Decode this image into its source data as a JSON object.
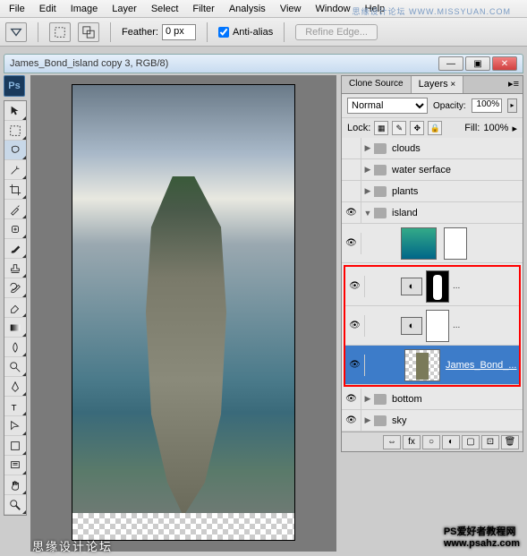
{
  "menu": {
    "items": [
      "File",
      "Edit",
      "Image",
      "Layer",
      "Select",
      "Filter",
      "Analysis",
      "View",
      "Window",
      "Help"
    ],
    "watermark": "思缘设计论坛  WWW.MISSYUAN.COM"
  },
  "options": {
    "feather_label": "Feather:",
    "feather_value": "0 px",
    "antialias_label": "Anti-alias",
    "antialias_checked": true,
    "refine_label": "Refine Edge..."
  },
  "doc": {
    "title": "James_Bond_island copy 3, RGB/8)",
    "ps_label": "Ps"
  },
  "panels": {
    "tabs": [
      "Clone Source",
      "Layers"
    ],
    "active_tab": 1,
    "blend_mode": "Normal",
    "opacity_label": "Opacity:",
    "opacity_value": "100%",
    "lock_label": "Lock:",
    "fill_label": "Fill:",
    "fill_value": "100%"
  },
  "layers": [
    {
      "type": "group",
      "vis": false,
      "expanded": false,
      "name": "clouds"
    },
    {
      "type": "group",
      "vis": false,
      "expanded": false,
      "name": "water serface"
    },
    {
      "type": "group",
      "vis": false,
      "expanded": false,
      "name": "plants"
    },
    {
      "type": "group",
      "vis": true,
      "expanded": true,
      "name": "island"
    },
    {
      "type": "image",
      "vis": true,
      "indent": 2,
      "thumb": "ocean",
      "mask": "white-shape"
    },
    {
      "type": "adjust",
      "vis": true,
      "indent": 2,
      "mask": "black",
      "link": "..."
    },
    {
      "type": "adjust",
      "vis": true,
      "indent": 2,
      "mask": "white",
      "link": "..."
    },
    {
      "type": "image",
      "vis": true,
      "indent": 2,
      "thumb": "rock",
      "name": "James_Bond_...",
      "selected": true
    },
    {
      "type": "group",
      "vis": true,
      "expanded": false,
      "name": "bottom"
    },
    {
      "type": "group",
      "vis": true,
      "expanded": false,
      "name": "sky"
    }
  ],
  "footer_icons": [
    "⇔",
    "fx",
    "○",
    "◐",
    "▢",
    "⊡",
    "🗑"
  ],
  "watermarks": {
    "left": "思缘设计论坛",
    "right_top": "PS爱好者教程网",
    "right_sub": "www.psahz.com"
  },
  "tools": [
    "move",
    "marquee",
    "lasso",
    "wand",
    "crop",
    "eyedrop",
    "heal",
    "brush",
    "stamp",
    "history",
    "eraser",
    "gradient",
    "blur",
    "dodge",
    "pen",
    "type",
    "path",
    "shape",
    "notes",
    "hand",
    "zoom"
  ],
  "selected_tool": 2
}
